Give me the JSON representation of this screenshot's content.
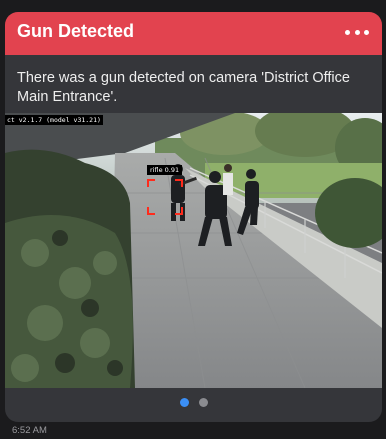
{
  "notification": {
    "title": "Gun Detected",
    "message": "There was a gun detected on camera 'District Office Main Entrance'.",
    "menu_icon": "more-horizontal-icon"
  },
  "camera": {
    "overlay_text": "ct v2.1.7 (model v31.21)",
    "detection": {
      "label": "rifle 0.91",
      "box_color": "#ff2b1c"
    }
  },
  "pager": {
    "pages": 2,
    "active_index": 0
  },
  "timestamp": "6:52 AM",
  "colors": {
    "header": "#e2434f",
    "card": "#35363a",
    "active_dot": "#3b8ff5"
  }
}
